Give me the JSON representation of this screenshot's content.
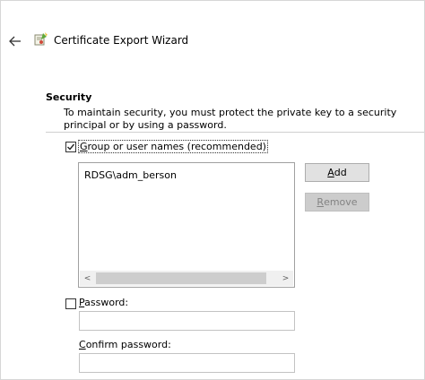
{
  "window": {
    "title": "Certificate Export Wizard",
    "back_icon": "back-arrow-icon",
    "app_icon": "certificate-wizard-icon"
  },
  "security": {
    "heading": "Security",
    "description": "To maintain security, you must protect the private key to a security principal or by using a password."
  },
  "group_option": {
    "checked": true,
    "label": "Group or user names (recommended)"
  },
  "principals": {
    "items": [
      "RDSG\\adm_berson"
    ],
    "scroll_left_glyph": "<",
    "scroll_right_glyph": ">"
  },
  "buttons": {
    "add_label": "Add",
    "remove_label": "Remove",
    "remove_enabled": false
  },
  "password_option": {
    "checked": false,
    "label": "Password:",
    "value": ""
  },
  "confirm_password": {
    "label": "Confirm password:",
    "value": ""
  }
}
